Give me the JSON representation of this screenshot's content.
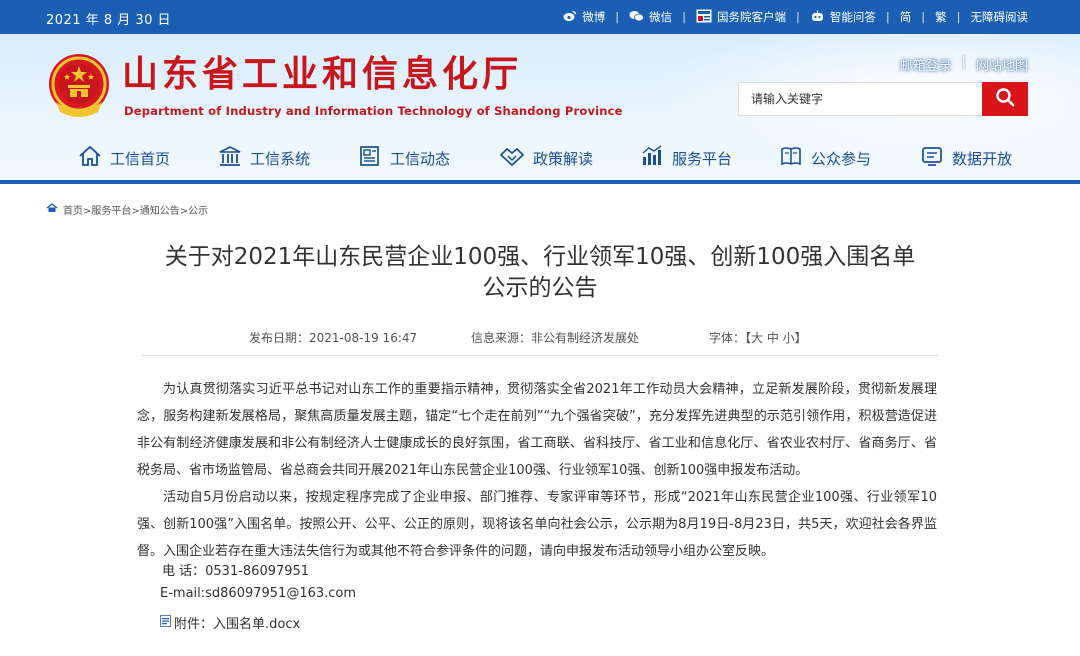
{
  "topbar": {
    "date": "2021 年 8 月 30 日",
    "links": [
      {
        "label": "微博",
        "icon": "weibo-icon"
      },
      {
        "label": "微信",
        "icon": "wechat-icon"
      },
      {
        "label": "国务院客户端",
        "icon": "gov-app-icon"
      },
      {
        "label": "智能问答",
        "icon": "robot-icon"
      },
      {
        "label": "简",
        "icon": ""
      },
      {
        "label": "繁",
        "icon": ""
      },
      {
        "label": "无障碍阅读",
        "icon": ""
      }
    ]
  },
  "header": {
    "title": "山东省工业和信息化厅",
    "subtitle": "Department of Industry and Information Technology of Shandong Province",
    "links": [
      "邮箱登录",
      "网站地图"
    ]
  },
  "search": {
    "placeholder": "请输入关键字"
  },
  "nav": [
    {
      "label": "工信首页",
      "icon": "home-icon"
    },
    {
      "label": "工信系统",
      "icon": "institution-icon"
    },
    {
      "label": "工信动态",
      "icon": "news-icon"
    },
    {
      "label": "政策解读",
      "icon": "handshake-icon"
    },
    {
      "label": "服务平台",
      "icon": "chart-icon"
    },
    {
      "label": "公众参与",
      "icon": "book-icon"
    },
    {
      "label": "数据开放",
      "icon": "data-icon"
    }
  ],
  "breadcrumb": {
    "text": "首页>服务平台>通知公告>公示"
  },
  "article": {
    "title_line1": "关于对2021年山东民营企业100强、行业领军10强、创新100强入围名单",
    "title_line2": "公示的公告",
    "date": "发布日期：2021-08-19 16:47",
    "source": "信息来源：非公有制经济发展处",
    "font_size": "字体：【大 中 小】",
    "paragraphs": [
      "为认真贯彻落实习近平总书记对山东工作的重要指示精神，贯彻落实全省2021年工作动员大会精神，立足新发展阶段，贯彻新发展理念，服务构建新发展格局，聚焦高质量发展主题，锚定“七个走在前列”“九个强省突破”，充分发挥先进典型的示范引领作用，积极营造促进非公有制经济健康发展和非公有制经济人士健康成长的良好氛围，省工商联、省科技厅、省工业和信息化厅、省农业农村厅、省商务厅、省税务局、省市场监管局、省总商会共同开展2021年山东民营企业100强、行业领军10强、创新100强申报发布活动。",
      "活动自5月份启动以来，按规定程序完成了企业申报、部门推荐、专家评审等环节，形成“2021年山东民营企业100强、行业领军10强、创新100强”入围名单。按照公开、公平、公正的原则，现将该名单向社会公示，公示期为8月19日-8月23日，共5天，欢迎社会各界监督。入围企业若存在重大违法失信行为或其他不符合参评条件的问题，请向申报发布活动领导小组办公室反映。"
    ],
    "phone": "电  话：0531-86097951",
    "email": "E-mail:sd86097951@163.com",
    "attachment": "附件：入围名单.docx"
  },
  "colors": {
    "brand_blue": "#1a5fb4",
    "brand_red": "#c8161d",
    "nav_text": "#1a4f98"
  }
}
